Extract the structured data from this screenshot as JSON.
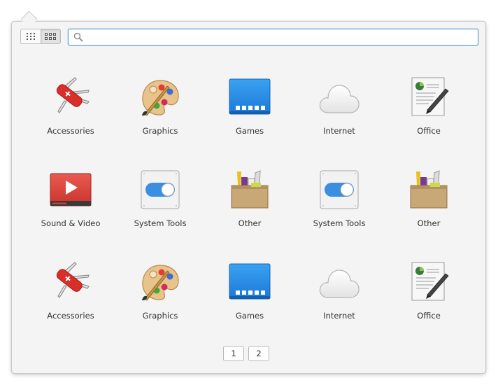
{
  "search": {
    "placeholder": "",
    "value": ""
  },
  "view_switch": {
    "selected": "category",
    "options": [
      "grid-icon",
      "category-icon"
    ]
  },
  "categories": [
    {
      "label": "Accessories",
      "icon": "swiss-knife-icon"
    },
    {
      "label": "Graphics",
      "icon": "paint-palette-icon"
    },
    {
      "label": "Games",
      "icon": "games-icon"
    },
    {
      "label": "Internet",
      "icon": "cloud-icon"
    },
    {
      "label": "Office",
      "icon": "office-document-icon"
    },
    {
      "label": "Sound & Video",
      "icon": "video-player-icon"
    },
    {
      "label": "System Tools",
      "icon": "toggle-switch-icon"
    },
    {
      "label": "Other",
      "icon": "toolbox-icon"
    },
    {
      "label": "System Tools",
      "icon": "toggle-switch-icon"
    },
    {
      "label": "Other",
      "icon": "toolbox-icon"
    },
    {
      "label": "Accessories",
      "icon": "swiss-knife-icon"
    },
    {
      "label": "Graphics",
      "icon": "paint-palette-icon"
    },
    {
      "label": "Games",
      "icon": "games-icon"
    },
    {
      "label": "Internet",
      "icon": "cloud-icon"
    },
    {
      "label": "Office",
      "icon": "office-document-icon"
    }
  ],
  "pagination": {
    "pages": [
      "1",
      "2"
    ],
    "current": "1"
  },
  "colors": {
    "accent": "#5aa1d9",
    "games_blue": "#2d8fe6",
    "video_red": "#d9413a",
    "toggle_blue": "#3a8fe0"
  }
}
